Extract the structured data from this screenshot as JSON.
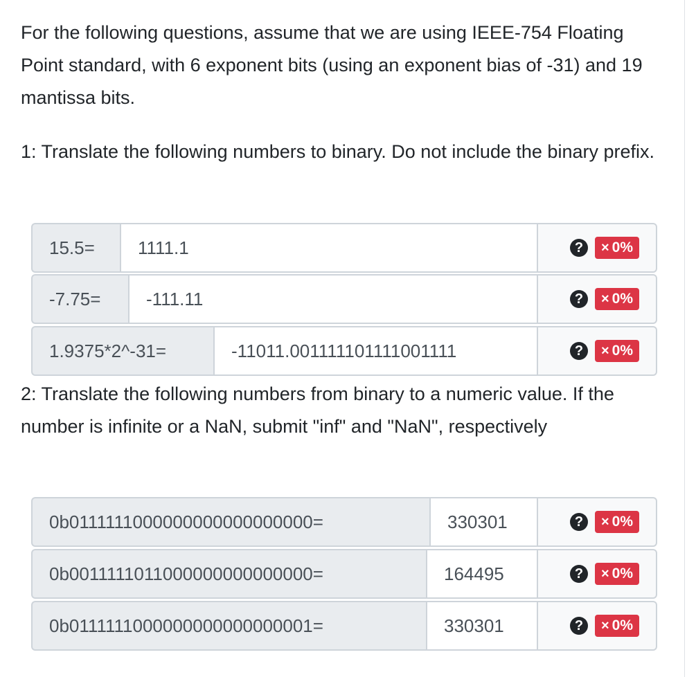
{
  "intro": "For the following questions, assume that we are using IEEE-754 Floating Point standard, with 6 exponent bits (using an exponent bias of -31) and 19 mantissa bits.",
  "q1": "1: Translate the following numbers to binary. Do not include the binary prefix.",
  "q2": "2: Translate the following numbers from binary to a numeric value. If the number is infinite or a NaN, submit \"inf\" and \"NaN\", respectively",
  "help_glyph": "?",
  "score_x": "×",
  "score": "0%",
  "rows1": [
    {
      "label": "15.5=",
      "value": "1111.1"
    },
    {
      "label": "-7.75=",
      "value": "-111.11"
    },
    {
      "label": "1.9375*2^-31=",
      "value": "-11011.001111101111001111"
    }
  ],
  "rows2": [
    {
      "label": "0b0111111000000000000000000=",
      "value": "330301"
    },
    {
      "label": "0b0011111011000000000000000=",
      "value": "164495"
    },
    {
      "label": "0b0111111000000000000000001=",
      "value": "330301"
    }
  ]
}
